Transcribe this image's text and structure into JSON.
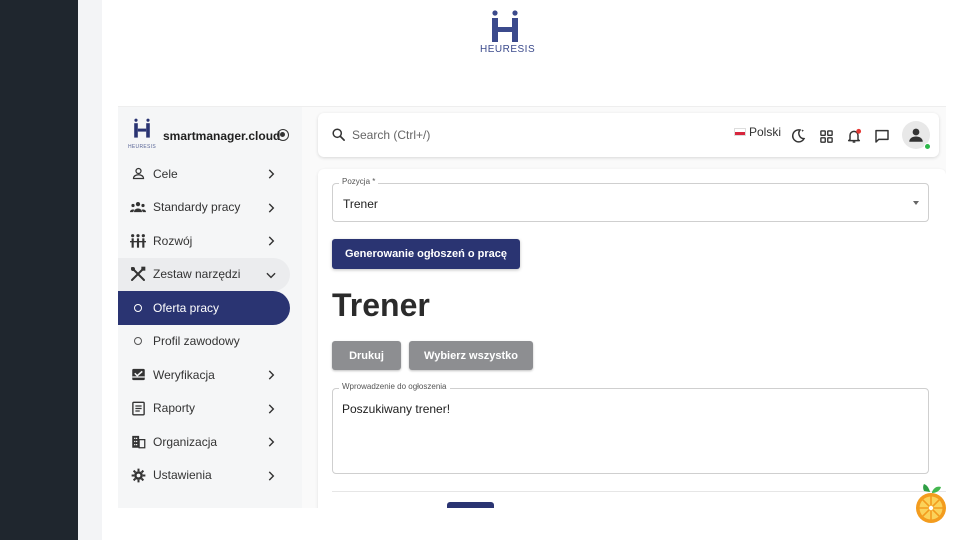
{
  "branding": {
    "name": "HEURESIS"
  },
  "sidebar": {
    "site_title": "smartmanager.cloud",
    "items": [
      {
        "label": "Cele",
        "icon": "person-icon"
      },
      {
        "label": "Standardy pracy",
        "icon": "group-icon"
      },
      {
        "label": "Rozwój",
        "icon": "development-icon"
      },
      {
        "label": "Zestaw narzędzi",
        "icon": "tools-icon"
      },
      {
        "label": "Oferta pracy",
        "icon": "circle-icon"
      },
      {
        "label": "Profil zawodowy",
        "icon": "circle-icon"
      },
      {
        "label": "Weryfikacja",
        "icon": "inbox-check-icon"
      },
      {
        "label": "Raporty",
        "icon": "report-icon"
      },
      {
        "label": "Organizacja",
        "icon": "building-icon"
      },
      {
        "label": "Ustawienia",
        "icon": "gear-icon"
      }
    ]
  },
  "topbar": {
    "search_placeholder": "Search (Ctrl+/)",
    "language": "Polski"
  },
  "form": {
    "position_label": "Pozycja *",
    "position_value": "Trener",
    "generate_button": "Generowanie ogłoszeń o pracę",
    "heading": "Trener",
    "print_button": "Drukuj",
    "select_all_button": "Wybierz wszystko",
    "intro_label": "Wprowadzenie do ogłoszenia",
    "intro_value": "Poszukiwany trener!"
  },
  "colors": {
    "primary": "#2a3472",
    "grey_button": "#8d8e91",
    "dark_sidebar": "#1f262e",
    "notification": "#e53935",
    "online": "#2eb84b"
  }
}
